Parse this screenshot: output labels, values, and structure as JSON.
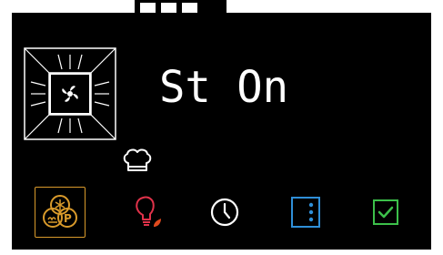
{
  "display": {
    "status_text": "St On"
  },
  "icons": {
    "top_tab": "top-tab-indicator",
    "oven_cavity": "oven-cavity-icon",
    "fan": "fan-icon",
    "chef_hat": "chef-hat-icon",
    "mode": "mode-combo-icon",
    "light": "lamp-eco-icon",
    "clock": "clock-icon",
    "menu": "vertical-menu-icon",
    "check": "checkmark-icon"
  },
  "colors": {
    "background": "#000000",
    "foreground": "#ffffff",
    "mode_accent": "#d99a2b",
    "light_red": "#e0324a",
    "light_leaf": "#e04a1e",
    "menu_blue": "#2f8fd8",
    "check_green": "#3cc04a"
  }
}
